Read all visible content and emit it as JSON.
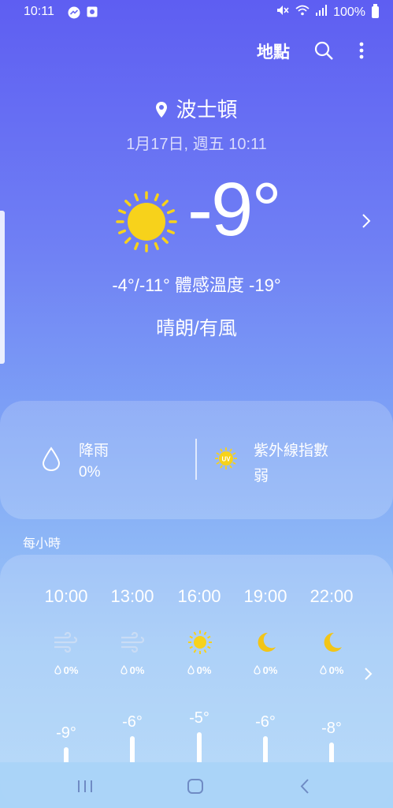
{
  "status": {
    "time": "10:11",
    "battery": "100%"
  },
  "topbar": {
    "location_label": "地點"
  },
  "current": {
    "city": "波士頓",
    "datetime": "1月17日, 週五 10:11",
    "temp": "-9°",
    "hi_lo_feels": "-4°/-11° 體感溫度 -19°",
    "condition": "晴朗/有風"
  },
  "details": {
    "rain_label": "降雨",
    "rain_value": "0%",
    "uv_label": "紫外線指數",
    "uv_value": "弱",
    "uv_icon_text": "UV"
  },
  "hourly": {
    "title": "每小時",
    "items": [
      {
        "time": "10:00",
        "icon": "wind-icon",
        "rain": "0%",
        "temp": "-9°"
      },
      {
        "time": "13:00",
        "icon": "wind-icon",
        "rain": "0%",
        "temp": "-6°"
      },
      {
        "time": "16:00",
        "icon": "sun-icon",
        "rain": "0%",
        "temp": "-5°"
      },
      {
        "time": "19:00",
        "icon": "moon-icon",
        "rain": "0%",
        "temp": "-6°"
      },
      {
        "time": "22:00",
        "icon": "moon-icon",
        "rain": "0%",
        "temp": "-8°"
      }
    ]
  },
  "colors": {
    "sun": "#f7d21b",
    "moon": "#f2c518",
    "wind": "#c9dcf5"
  }
}
